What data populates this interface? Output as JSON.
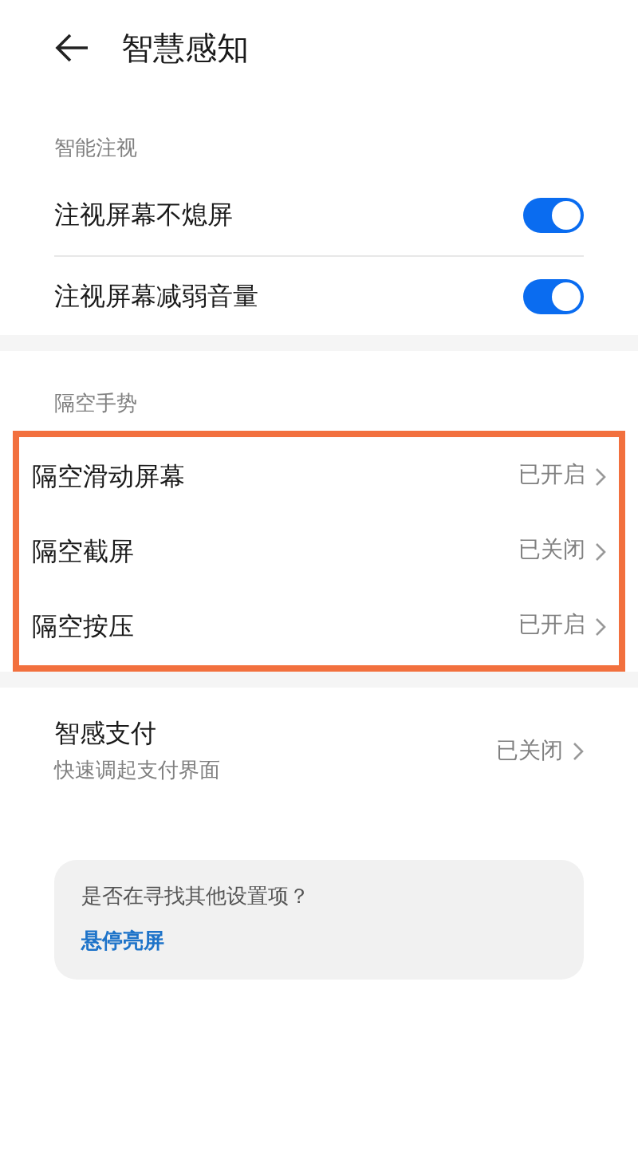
{
  "header": {
    "title": "智慧感知"
  },
  "sections": [
    {
      "label": "智能注视",
      "highlighted": false,
      "items": [
        {
          "kind": "toggle",
          "label": "注视屏幕不熄屏",
          "on": true
        },
        {
          "kind": "toggle",
          "label": "注视屏幕减弱音量",
          "on": true
        }
      ]
    },
    {
      "label": "隔空手势",
      "highlighted": true,
      "items": [
        {
          "kind": "link",
          "label": "隔空滑动屏幕",
          "value": "已开启"
        },
        {
          "kind": "link",
          "label": "隔空截屏",
          "value": "已关闭"
        },
        {
          "kind": "link",
          "label": "隔空按压",
          "value": "已开启"
        }
      ]
    },
    {
      "highlighted": false,
      "items": [
        {
          "kind": "link",
          "label": "智感支付",
          "subtitle": "快速调起支付界面",
          "value": "已关闭"
        }
      ]
    }
  ],
  "suggestion": {
    "question": "是否在寻找其他设置项？",
    "link": "悬停亮屏"
  }
}
